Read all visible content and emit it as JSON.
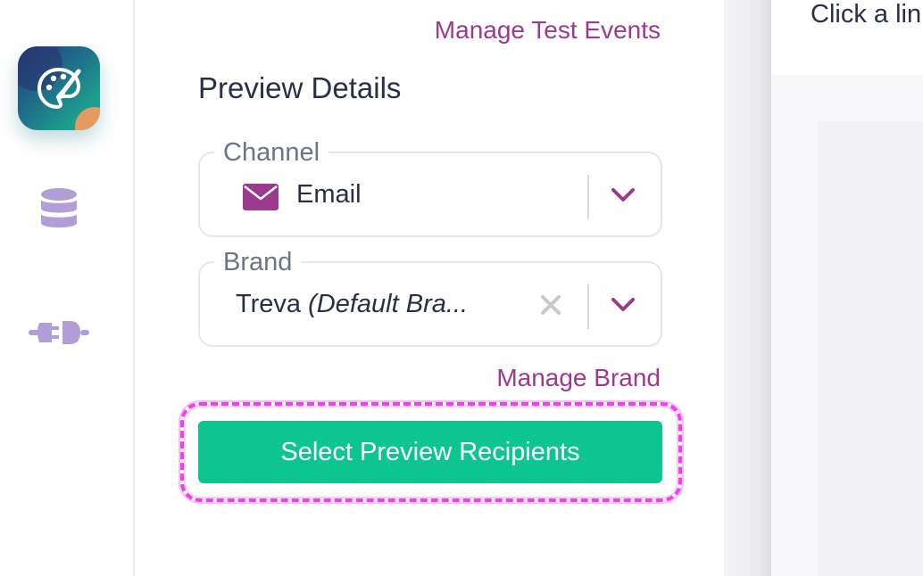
{
  "sidebar": {
    "items": [
      {
        "icon": "palette-icon",
        "active": true
      },
      {
        "icon": "database-icon",
        "active": false
      },
      {
        "icon": "plug-icon",
        "active": false
      }
    ]
  },
  "panel": {
    "manage_test_events_label": "Manage Test Events",
    "section_title": "Preview Details",
    "channel": {
      "label": "Channel",
      "value": "Email",
      "icon": "envelope-icon"
    },
    "brand": {
      "label": "Brand",
      "value_name": "Treva",
      "value_suffix": "(Default Bra..."
    },
    "manage_brand_label": "Manage Brand",
    "cta_label": "Select Preview Recipients"
  },
  "right_pane": {
    "hint_text": "Click a lin"
  },
  "colors": {
    "accent_link": "#9b3a8e",
    "cta_green": "#0cc590",
    "highlight_magenta": "#f040ea",
    "sidebar_icon": "#b19dd8"
  }
}
